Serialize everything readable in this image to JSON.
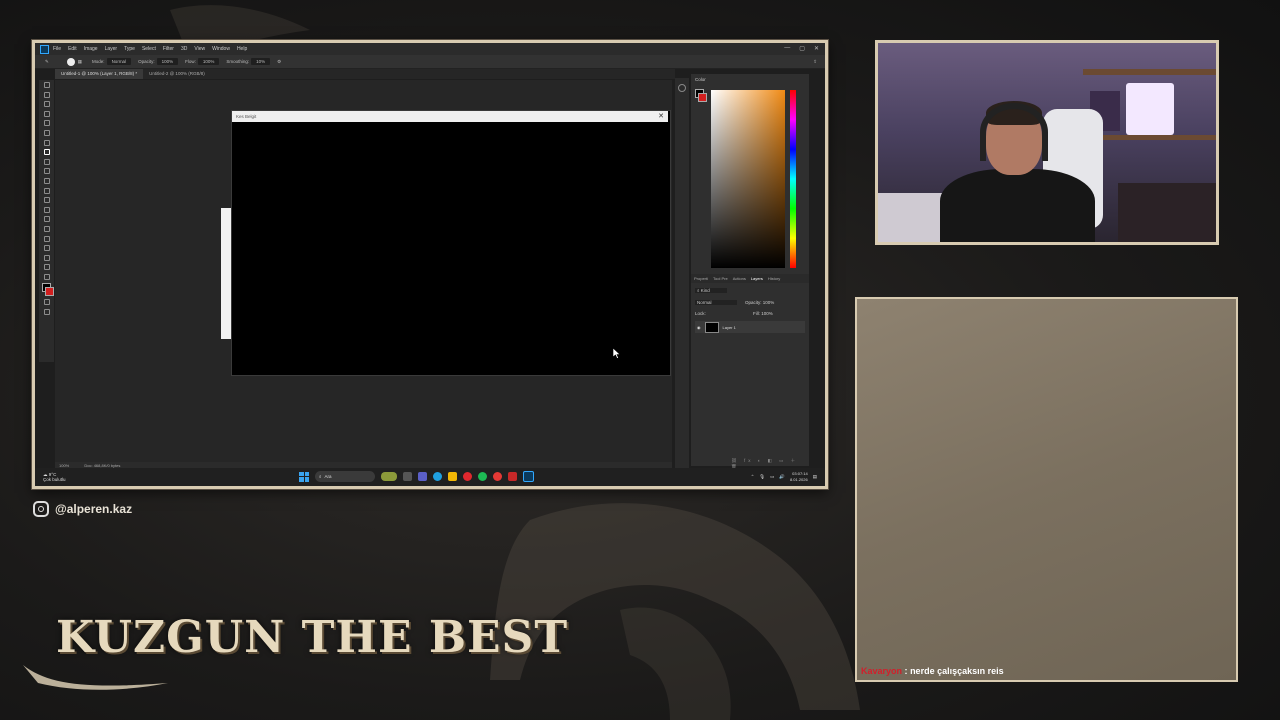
{
  "photoshop": {
    "menu": [
      "File",
      "Edit",
      "Image",
      "Layer",
      "Type",
      "Select",
      "Filter",
      "3D",
      "View",
      "Window",
      "Help"
    ],
    "options": {
      "mode_label": "Mode:",
      "mode_value": "Normal",
      "opacity_label": "Opacity:",
      "opacity_value": "100%",
      "flow_label": "Flow:",
      "flow_value": "100%",
      "smoothing_label": "Smoothing:",
      "smoothing_value": "10%"
    },
    "tabs": [
      "Untitled-1 @ 100% (Layer 1, RGB/8) *",
      "Untitled-2 @ 100% (RGB/8)"
    ],
    "floating_window_title": "Kes Belgit",
    "panels": {
      "color_title": "Color",
      "layer_tabs": [
        "Properti",
        "Tool Pre",
        "Actions",
        "Layers",
        "History"
      ],
      "kind": "Kind",
      "blend_mode": "Normal",
      "opacity_label": "Opacity:",
      "opacity_value": "100%",
      "lock_label": "Lock:",
      "fill_label": "Fill:",
      "fill_value": "100%",
      "layer_name": "Layer 1"
    },
    "status": {
      "zoom": "100%",
      "doc": "Doc: 468,8K/0 bytes"
    }
  },
  "taskbar": {
    "weather_temp": "9°C",
    "weather_desc": "Çok bulutlu",
    "search_placeholder": "Ara",
    "time": "03:07:14",
    "date": "8.01.2026"
  },
  "chat": {
    "username": "Kavaryon",
    "separator": ":",
    "message": "nerde çalışçaksın reis"
  },
  "social": {
    "instagram_handle": "@alperen.kaz"
  },
  "overlay": {
    "brand_title": "KUZGUN THE BEST"
  },
  "colors": {
    "frame": "#d8cbb1",
    "chat_user": "#d21f2b",
    "ps_accent": "#31a8ff"
  }
}
